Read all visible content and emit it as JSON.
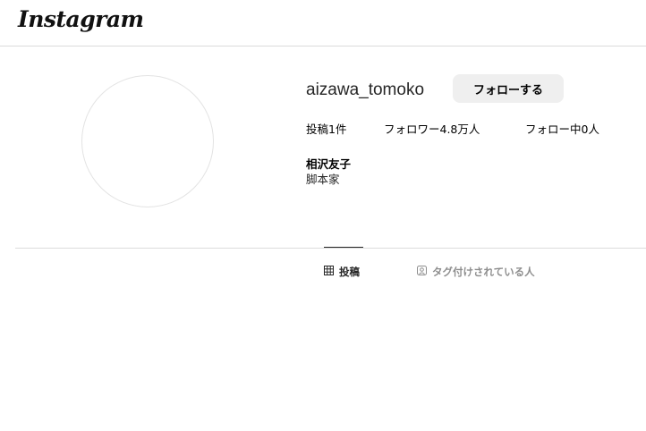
{
  "header": {
    "logo_text": "Instagram"
  },
  "profile": {
    "username": "aizawa_tomoko",
    "follow_button_label": "フォローする",
    "stats": {
      "posts": "投稿1件",
      "followers": "フォロワー4.8万人",
      "following": "フォロー中0人"
    },
    "full_name": "相沢友子",
    "bio": "脚本家"
  },
  "tabs": [
    {
      "label": "投稿",
      "icon": "grid-icon",
      "active": true
    },
    {
      "label": "タグ付けされている人",
      "icon": "tagged-person-icon",
      "active": false
    }
  ],
  "colors": {
    "button_bg": "#efefef",
    "border": "#dbdbdb",
    "inactive_tab": "#8e8e8e"
  }
}
